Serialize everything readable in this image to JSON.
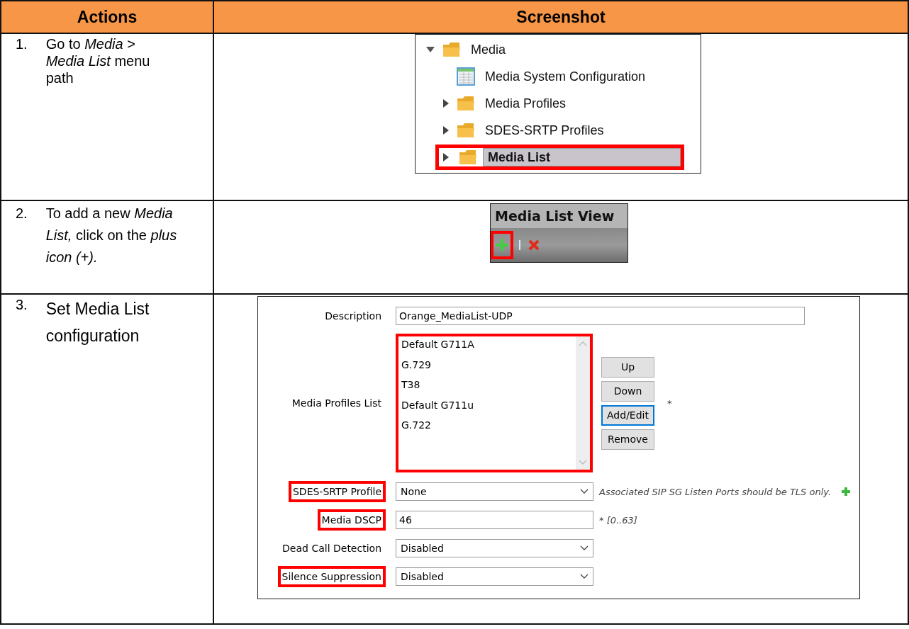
{
  "table": {
    "columns": [
      "Actions",
      "Screenshot"
    ],
    "rows": [
      {
        "number": "1.",
        "action": "Go to *Media* > *Media List* menu path",
        "kind": "tree",
        "tree": [
          {
            "label": "Media",
            "kind": "folder",
            "expanded": true,
            "highlighted": false,
            "selected": false,
            "children": [
              {
                "label": "Media System Configuration",
                "kind": "table",
                "highlighted": false,
                "selected": false
              },
              {
                "label": "Media Profiles",
                "kind": "folder",
                "expanded": false,
                "highlighted": false,
                "selected": false
              },
              {
                "label": "SDES-SRTP Profiles",
                "kind": "folder",
                "expanded": false,
                "highlighted": false,
                "selected": false
              },
              {
                "label": "Media List",
                "kind": "folder",
                "expanded": false,
                "highlighted": true,
                "selected": true
              }
            ]
          }
        ]
      },
      {
        "number": "2.",
        "action": "To add a new *Media List,* click on the *plus icon (+).*",
        "kind": "toolbar",
        "toolbar": {
          "title": "Media List View",
          "buttons": [
            {
              "kind": "add",
              "highlighted": true
            },
            {
              "kind": "delete",
              "highlighted": false
            }
          ]
        }
      },
      {
        "number": "3.",
        "action": "Set Media List configuration",
        "kind": "form",
        "fields": [
          {
            "kind": "text",
            "label": "Description",
            "value": "Orange_MediaList-UDP",
            "highlighted": false
          },
          {
            "kind": "list",
            "label": "Media Profiles List",
            "highlighted": false,
            "list_highlighted": true,
            "items": [
              "Default G711A",
              "G.729",
              "T38",
              "Default G711u",
              "G.722"
            ],
            "buttons": [
              {
                "label": "Up",
                "focused": false
              },
              {
                "label": "Down",
                "focused": false
              },
              {
                "label": "Add/Edit",
                "focused": true
              },
              {
                "label": "Remove",
                "focused": false
              }
            ],
            "note": "*"
          },
          {
            "kind": "select",
            "label": "SDES-SRTP Profile",
            "value": "None",
            "highlighted": true,
            "note": "Associated SIP SG Listen Ports should be TLS only.",
            "add_icon": true
          },
          {
            "kind": "text",
            "label": "Media DSCP",
            "value": "46",
            "highlighted": true,
            "note": "* [0..63]"
          },
          {
            "kind": "select",
            "label": "Dead Call Detection",
            "value": "Disabled",
            "highlighted": false
          },
          {
            "kind": "select",
            "label": "Silence Suppression",
            "value": "Disabled",
            "highlighted": true
          }
        ]
      }
    ]
  }
}
